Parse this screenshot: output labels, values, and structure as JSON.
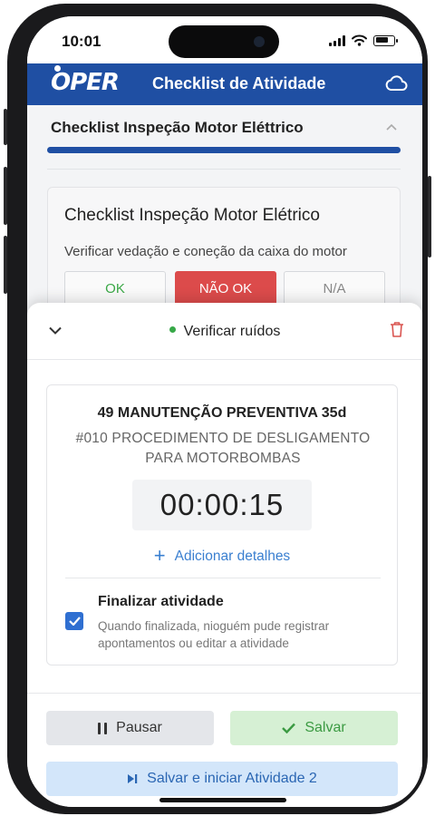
{
  "status_bar": {
    "time": "10:01"
  },
  "app_bar": {
    "logo": "OPER",
    "title": "Checklist de Atividade",
    "sync_icon": "cloud-icon"
  },
  "section": {
    "title": "Checklist Inspeção Motor Eléttrico",
    "progress": 1.0,
    "colors": {
      "brand": "#1f4fa3"
    }
  },
  "card": {
    "title": "Checklist Inspeção Motor Elétrico",
    "question": "Verificar vedação e coneção da caixa do motor",
    "options": {
      "ok": "OK",
      "not_ok": "NÃO OK",
      "na": "N/A"
    },
    "selected": "NÃO OK"
  },
  "sheet": {
    "title": "Verificar ruídos",
    "activity_name": "49 MANUTENÇÃO PREVENTIVA 35d",
    "procedure": "#010 PROCEDIMENTO DE DESLIGAMENTO PARA MOTORBOMBAS",
    "timer": "00:00:15",
    "add_details": "Adicionar detalhes",
    "finalize": {
      "checked": true,
      "title": "Finalizar atividade",
      "description": "Quando finalizada, nioguém pude registrar apontamentos ou editar a atividade"
    },
    "buttons": {
      "pause": "Pausar",
      "save": "Salvar",
      "save_next": "Salvar e iniciar Atividade 2"
    }
  }
}
